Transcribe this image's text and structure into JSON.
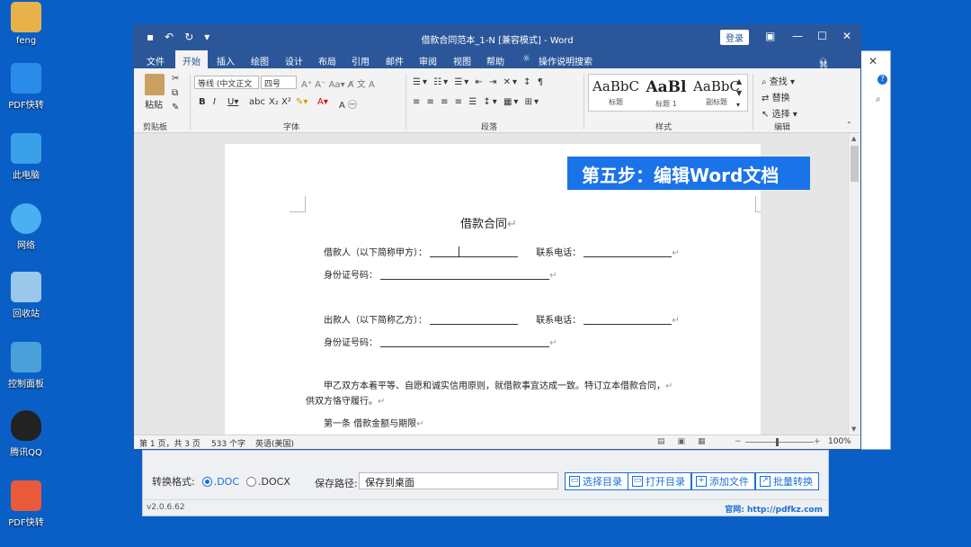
{
  "desktop": [
    {
      "label": "feng",
      "color": "#e8b24a"
    },
    {
      "label": "PDF快转",
      "color": "#2a8be8"
    },
    {
      "label": "此电脑",
      "color": "#3aa0e8"
    },
    {
      "label": "网络",
      "color": "#4ab0f0"
    },
    {
      "label": "回收站",
      "color": "#9ac8ea"
    },
    {
      "label": "控制面板",
      "color": "#4aa0d8"
    },
    {
      "label": "腾讯QQ",
      "color": "#222222"
    },
    {
      "label": "PDF快转",
      "color": "#e85a3a"
    }
  ],
  "word": {
    "title": "借款合同范本_1-N [兼容模式] - Word",
    "login": "登录",
    "tabs": [
      "文件",
      "开始",
      "插入",
      "绘图",
      "设计",
      "布局",
      "引用",
      "邮件",
      "审阅",
      "视图",
      "帮助",
      "操作说明搜索"
    ],
    "share": "共享",
    "ribbon": {
      "paste": "粘贴",
      "font_name": "等线 (中文正文",
      "font_size": "四号",
      "groups": {
        "clipboard": "剪贴板",
        "font": "字体",
        "paragraph": "段落",
        "styles": "样式",
        "edit": "编辑"
      },
      "styles": [
        {
          "preview": "AaBbC",
          "label": "标题"
        },
        {
          "preview": "AaBl",
          "label": "标题 1"
        },
        {
          "preview": "AaBbC",
          "label": "副标题"
        }
      ],
      "edit": {
        "find": "查找",
        "replace": "替换",
        "select": "选择"
      }
    },
    "banner": "第五步：编辑Word文档",
    "doc": {
      "heading": "借款合同",
      "borrower": "借款人（以下简称甲方）：",
      "phone1": "联系电话：",
      "id1": "身份证号码：",
      "lender": "出款人（以下简称乙方）：",
      "phone2": "联系电话：",
      "id2": "身份证号码：",
      "para1": "甲乙双方本着平等、自愿和诚实信用原则，就借款事宜达成一致。特订立本借款合同，",
      "para2": "供双方恪守履行。",
      "clause1": "第一条  借款金额与期限"
    },
    "status": {
      "page": "第 1 页，共 3 页",
      "words": "533 个字",
      "lang": "英语(美国)",
      "zoom": "100%"
    }
  },
  "converter": {
    "format_label": "转换格式:",
    "opt_doc": ".DOC",
    "opt_docx": ".DOCX",
    "selected": ".DOC",
    "path_label": "保存路径:",
    "path_value": "保存到桌面",
    "buttons": [
      "选择目录",
      "打开目录",
      "添加文件",
      "批量转换"
    ],
    "version": "v2.0.6.62",
    "website": "官网: http://pdfkz.com"
  }
}
